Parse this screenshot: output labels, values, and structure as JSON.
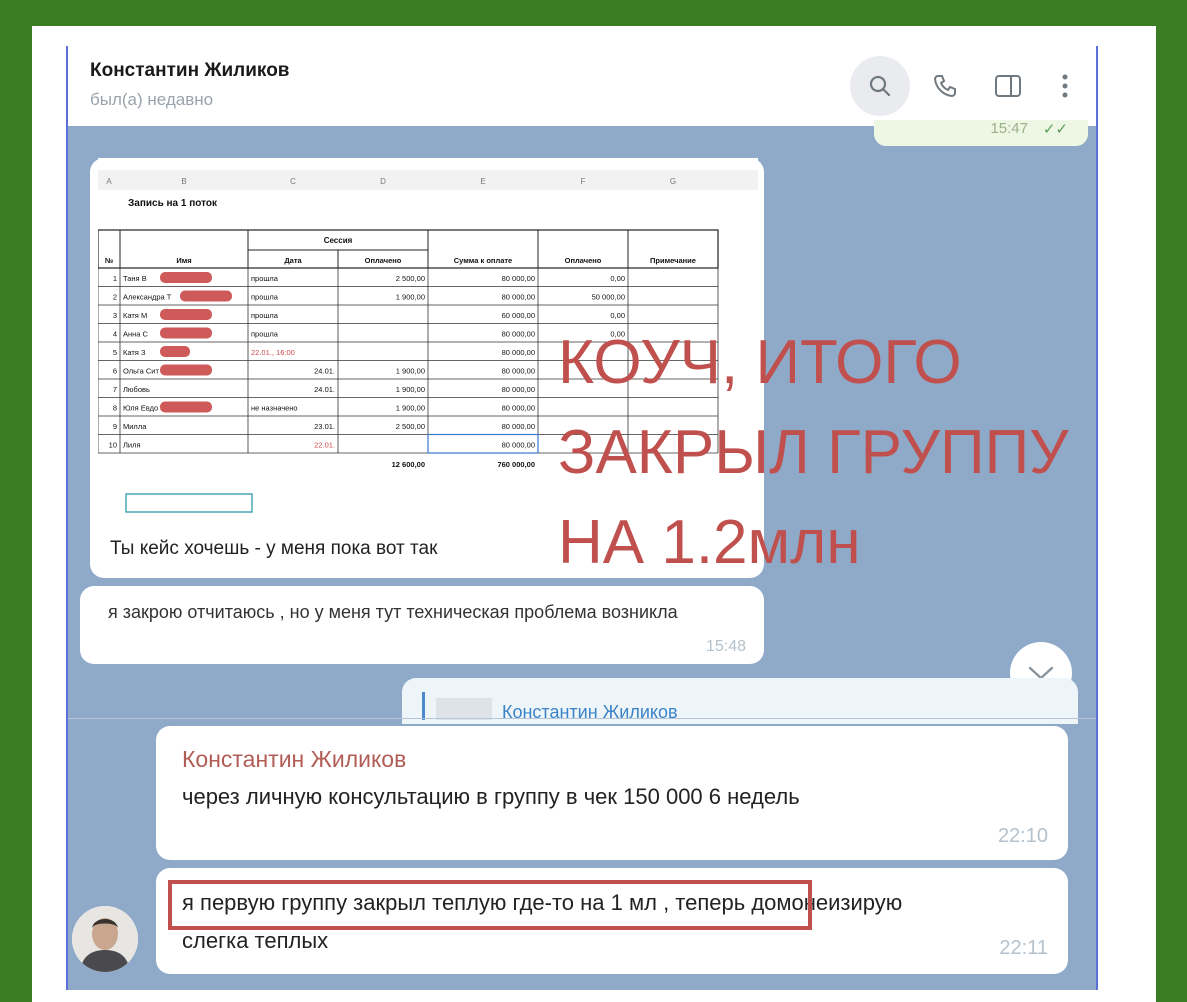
{
  "header": {
    "name": "Константин Жиликов",
    "status": "был(а) недавно"
  },
  "top_bubble_time": "15:47",
  "spreadsheet": {
    "title": "Запись на 1 поток",
    "col_letters": [
      "A",
      "B",
      "C",
      "D",
      "E",
      "F",
      "G"
    ],
    "group_header": "Сессия",
    "headers": [
      "№",
      "Имя",
      "Дата",
      "Оплачено",
      "Сумма к оплате",
      "Оплачено",
      "Примечание"
    ],
    "rows": [
      [
        "1",
        "Таня В",
        "прошла",
        "2 500,00",
        "80 000,00",
        "0,00",
        ""
      ],
      [
        "2",
        "Александра Т",
        "прошла",
        "1 900,00",
        "80 000,00",
        "50 000,00",
        ""
      ],
      [
        "3",
        "Катя М",
        "прошла",
        "",
        "60 000,00",
        "0,00",
        ""
      ],
      [
        "4",
        "Анна С",
        "прошла",
        "",
        "80 000,00",
        "0,00",
        ""
      ],
      [
        "5",
        "Катя З",
        "22.01., 16:00",
        "",
        "80 000,00",
        "",
        ""
      ],
      [
        "6",
        "Ольга Сит",
        "24.01.",
        "1 900,00",
        "80 000,00",
        "",
        ""
      ],
      [
        "7",
        "Любовь",
        "24.01.",
        "1 900,00",
        "80 000,00",
        "",
        ""
      ],
      [
        "8",
        "Юля Евдо",
        "не назначено",
        "1 900,00",
        "80 000,00",
        "",
        ""
      ],
      [
        "9",
        "Милла",
        "23.01.",
        "2 500,00",
        "80 000,00",
        "",
        ""
      ],
      [
        "10",
        "Лиля",
        "22.01.",
        "",
        "80 000,00",
        "",
        ""
      ]
    ],
    "totals": [
      "12 600,00",
      "760 000,00"
    ]
  },
  "image_caption": "Ты кейс хочешь - у меня пока вот так",
  "overlay_lines": [
    "КОУЧ, ИТОГО",
    "ЗАКРЫЛ ГРУППУ",
    "НА 1.2млн"
  ],
  "message2": {
    "text": "я закрою отчитаюсь , но у меня тут техническая проблема возникла",
    "time": "15:48"
  },
  "reply": {
    "name": "Константин Жиликов"
  },
  "message3": {
    "author": "Константин Жиликов",
    "text": "через личную консультацию в группу в чек 150 000 6 недель",
    "time": "22:10"
  },
  "message4": {
    "text": "я первую группу закрыл теплую  где-то на 1 мл , теперь домонеизирую  слегка теплых",
    "time": "22:11"
  },
  "colors": {
    "green_frame": "#3a7d22",
    "chat_bg": "#8faac8",
    "overlay_red": "#c0504d",
    "accent_blue": "#3b83c7"
  }
}
